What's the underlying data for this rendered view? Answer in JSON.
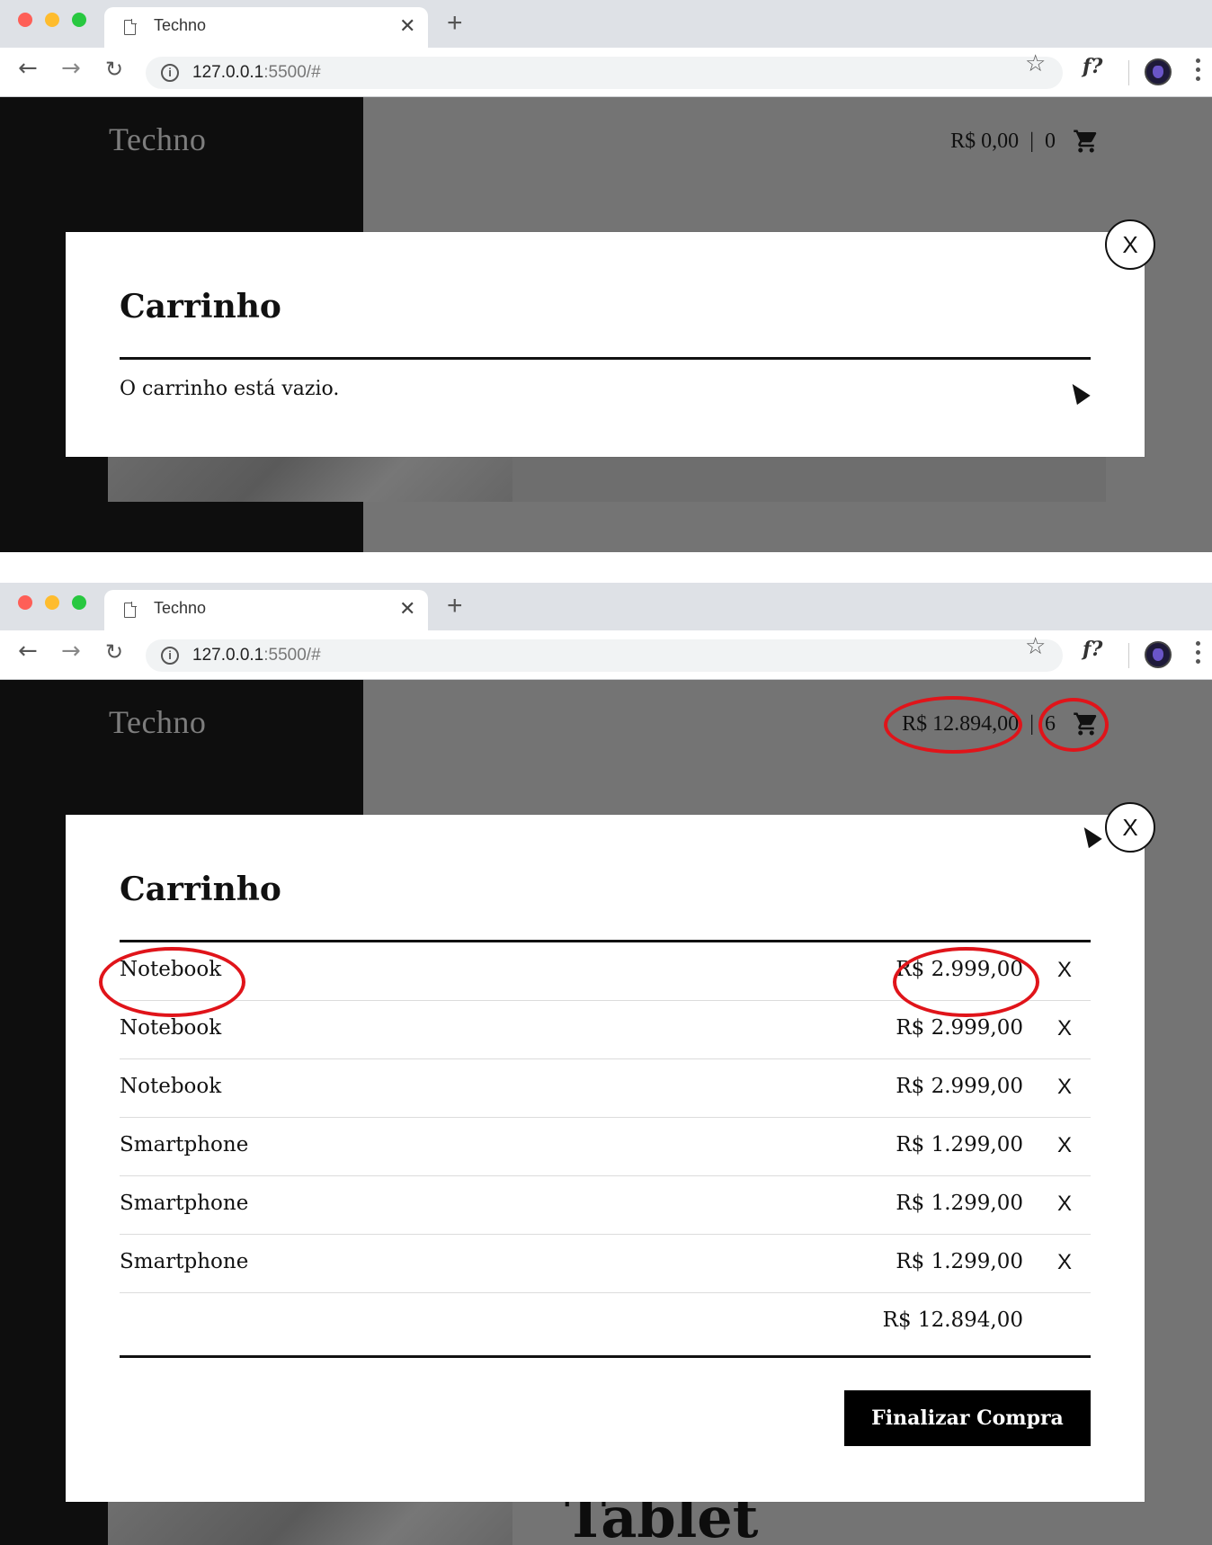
{
  "browser": {
    "tab_title": "Techno",
    "tab_close": "✕",
    "new_tab": "+",
    "url_host": "127.0.0.1",
    "url_path": ":5500/#",
    "info": "i",
    "ext_label": "f?"
  },
  "site": {
    "logo": "Techno"
  },
  "state_empty": {
    "cart_total": "R$ 0,00",
    "separator": "|",
    "cart_count": "0",
    "modal_close": "X",
    "modal_title": "Carrinho",
    "empty_message": "O carrinho está vazio."
  },
  "state_filled": {
    "cart_total": "R$ 12.894,00",
    "separator": "|",
    "cart_count": "6",
    "modal_close": "X",
    "modal_title": "Carrinho",
    "items": [
      {
        "name": "Notebook",
        "price": "R$ 2.999,00",
        "remove": "X"
      },
      {
        "name": "Notebook",
        "price": "R$ 2.999,00",
        "remove": "X"
      },
      {
        "name": "Notebook",
        "price": "R$ 2.999,00",
        "remove": "X"
      },
      {
        "name": "Smartphone",
        "price": "R$ 1.299,00",
        "remove": "X"
      },
      {
        "name": "Smartphone",
        "price": "R$ 1.299,00",
        "remove": "X"
      },
      {
        "name": "Smartphone",
        "price": "R$ 1.299,00",
        "remove": "X"
      }
    ],
    "list_total": "R$ 12.894,00",
    "checkout_label": "Finalizar Compra",
    "background_heading": "Tablet"
  },
  "colors": {
    "highlight": "#e0141a",
    "overlay": "#747474",
    "dark_panel": "#0e0e0e"
  }
}
